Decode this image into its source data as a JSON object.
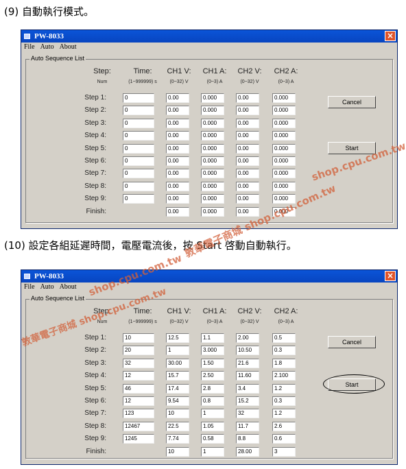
{
  "headings": {
    "step9": "(9) 自動執行模式。",
    "step10": "(10) 設定各組延遲時間，電壓電流後，按 Start 啓動自動執行。"
  },
  "window": {
    "title": "PW-8033",
    "menu": [
      "File",
      "Auto",
      "About"
    ],
    "group_label": "Auto Sequence List",
    "columns": [
      {
        "title": "Step:",
        "sub": "Num"
      },
      {
        "title": "Time:",
        "sub": "(1~999999) s"
      },
      {
        "title": "CH1 V:",
        "sub": "(0~32) V"
      },
      {
        "title": "CH1 A:",
        "sub": "(0~3) A"
      },
      {
        "title": "CH2 V:",
        "sub": "(0~32) V"
      },
      {
        "title": "CH2 A:",
        "sub": "(0~3) A"
      }
    ],
    "row_labels": [
      "Step 1:",
      "Step 2:",
      "Step 3:",
      "Step 4:",
      "Step 5:",
      "Step 6:",
      "Step 7:",
      "Step 8:",
      "Step 9:",
      "Finish:"
    ],
    "cancel_label": "Cancel",
    "start_label": "Start"
  },
  "table_before": [
    [
      "0",
      "0.00",
      "0.000",
      "0.00",
      "0.000"
    ],
    [
      "0",
      "0.00",
      "0.000",
      "0.00",
      "0.000"
    ],
    [
      "0",
      "0.00",
      "0.000",
      "0.00",
      "0.000"
    ],
    [
      "0",
      "0.00",
      "0.000",
      "0.00",
      "0.000"
    ],
    [
      "0",
      "0.00",
      "0.000",
      "0.00",
      "0.000"
    ],
    [
      "0",
      "0.00",
      "0.000",
      "0.00",
      "0.000"
    ],
    [
      "0",
      "0.00",
      "0.000",
      "0.00",
      "0.000"
    ],
    [
      "0",
      "0.00",
      "0.000",
      "0.00",
      "0.000"
    ],
    [
      "0",
      "0.00",
      "0.000",
      "0.00",
      "0.000"
    ],
    [
      "",
      "0.00",
      "0.000",
      "0.00",
      "0.000"
    ]
  ],
  "table_after": [
    [
      "10",
      "12.5",
      "1.1",
      "2.00",
      "0.5"
    ],
    [
      "20",
      "1",
      "3.000",
      "10.50",
      "0.3"
    ],
    [
      "32",
      "30.00",
      "1.50",
      "21.6",
      "1.8"
    ],
    [
      "12",
      "15.7",
      "2.50",
      "11.60",
      "2.100"
    ],
    [
      "46",
      "17.4",
      "2.8",
      "3.4",
      "1.2"
    ],
    [
      "12",
      "9.54",
      "0.8",
      "15.2",
      "0.3"
    ],
    [
      "123",
      "10",
      "1",
      "32",
      "1.2"
    ],
    [
      "12467",
      "22.5",
      "1.05",
      "11.7",
      "2.6"
    ],
    [
      "1245",
      "7.74",
      "0.58",
      "8.8",
      "0.6"
    ],
    [
      "",
      "10",
      "1",
      "28.00",
      "3"
    ]
  ],
  "watermarks": [
    "shop.cpu.com.tw",
    "敦華電子商城 shop.cpu.com.tw",
    "shop.cpu.com.tw",
    "敦華電子商城 shop.cpu.com.tw"
  ],
  "colors": {
    "titlebar": "#0a54d8",
    "window_bg": "#d4d0c8",
    "close_button": "#e0542a",
    "watermark": "#d2603a"
  }
}
